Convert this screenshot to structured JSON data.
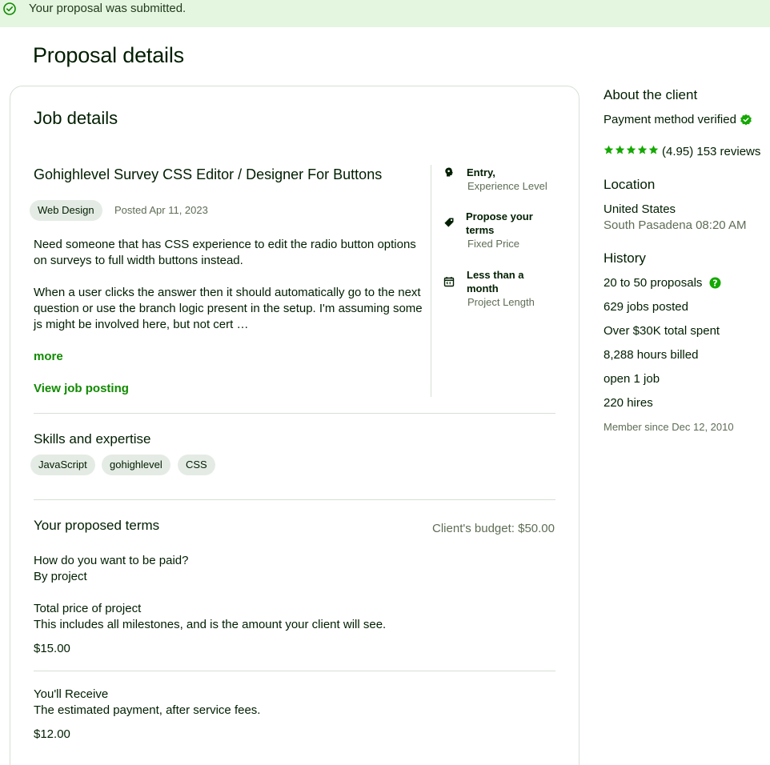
{
  "banner": {
    "message": "Your proposal was submitted."
  },
  "page_title": "Proposal details",
  "job_details": {
    "heading": "Job details",
    "title": "Gohighlevel Survey CSS Editor / Designer For Buttons",
    "category": "Web Design",
    "posted": "Posted Apr 11, 2023",
    "description_p1_l1": "Need someone that has CSS experience to edit the radio button options",
    "description_p1_l2": "on surveys to full width buttons instead.",
    "description_p2_l1": "When a user clicks the answer then it should automatically go to the next",
    "description_p2_l2": "question or use the branch logic present in the setup. I'm assuming some",
    "description_p2_l3": "js might be involved here, but not cert …",
    "more_label": "more",
    "view_posting_label": "View job posting",
    "sidebar": [
      {
        "icon": "brain-icon",
        "title": "Entry,",
        "subtitle": "Experience Level"
      },
      {
        "icon": "tag-icon",
        "title_l1": "Propose your",
        "title_l2": "terms",
        "subtitle": "Fixed Price"
      },
      {
        "icon": "calendar-icon",
        "title_l1": "Less than a",
        "title_l2": "month",
        "subtitle": "Project Length"
      }
    ]
  },
  "skills": {
    "heading": "Skills and expertise",
    "items": [
      "JavaScript",
      "gohighlevel",
      "CSS"
    ]
  },
  "terms": {
    "heading": "Your proposed terms",
    "client_budget": "Client's budget: $50.00",
    "paid_question": "How do you want to be paid?",
    "paid_answer": "By project",
    "total_heading": "Total price of project",
    "total_desc": "This includes all milestones, and is the amount your client will see.",
    "total_value": "$15.00",
    "receive_heading": "You'll Receive",
    "receive_desc": "The estimated payment, after service fees.",
    "receive_value": "$12.00"
  },
  "client": {
    "heading": "About the client",
    "payment_verified": "Payment method verified",
    "rating_value": 4.95,
    "rating_text": "(4.95) 153 reviews",
    "location_heading": "Location",
    "country": "United States",
    "city_time": "South Pasadena 08:20 AM",
    "history_heading": "History",
    "proposals": "20 to 50 proposals",
    "jobs_posted": "629 jobs posted",
    "total_spent": "Over $30K total spent",
    "hours_billed": "8,288 hours billed",
    "open_jobs": "open 1 job",
    "hires": "220 hires",
    "member_since": "Member since Dec 12, 2010"
  },
  "colors": {
    "accent": "#108a00",
    "banner_bg": "#e4f5e0",
    "pill_bg": "#e4ebe4",
    "text": "#001e00",
    "muted": "#5e6d55"
  }
}
